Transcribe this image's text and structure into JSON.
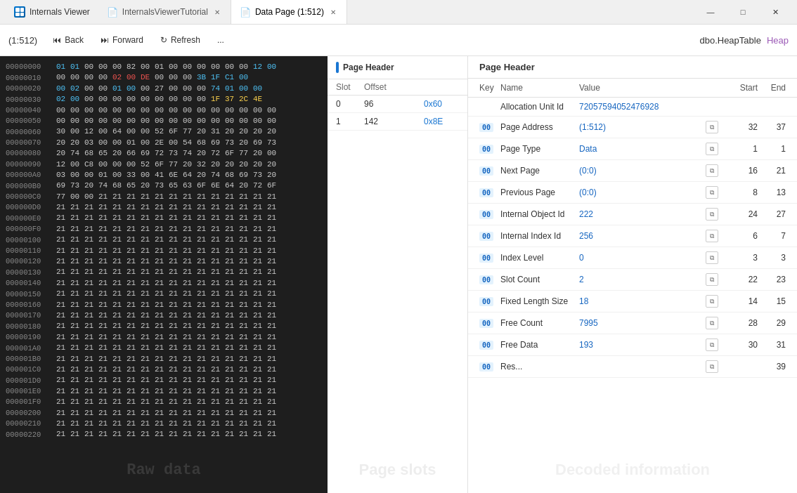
{
  "titlebar": {
    "app_name": "Internals Viewer",
    "tabs": [
      {
        "id": "tutorial",
        "label": "InternalsViewerTutorial",
        "icon": "📄",
        "active": false
      },
      {
        "id": "datapage",
        "label": "Data Page (1:512)",
        "icon": "📄",
        "active": true
      }
    ],
    "window_controls": {
      "minimize": "—",
      "maximize": "□",
      "close": "✕"
    }
  },
  "toolbar": {
    "page_ref": "(1:512)",
    "back_label": "Back",
    "forward_label": "Forward",
    "refresh_label": "Refresh",
    "more_label": "...",
    "dbo_text": "dbo.HeapTable",
    "heap_label": "Heap"
  },
  "hex_panel": {
    "watermark": "Raw data",
    "rows": [
      {
        "addr": "00000000",
        "bytes": "01 01 00 00 00 82 00 01 00 00 00 00 00 00 12 00"
      },
      {
        "addr": "00000010",
        "bytes": "00 00 00 00 02 00 DE 00 00 00 3B 1F C1 00"
      },
      {
        "addr": "00000020",
        "bytes": "00 02 00 00 01 00 00 27 00 00 00 74 01 00 00"
      },
      {
        "addr": "00000030",
        "bytes": "02 00 00 00 00 00 00 00 00 00 00 1F 37 2C 4E"
      },
      {
        "addr": "00000040",
        "bytes": "00 00 00 00 00 00 00 00 00 00 00 00 00 00 00 00"
      },
      {
        "addr": "00000050",
        "bytes": "00 00 00 00 00 00 00 00 00 00 00 00 00 00 00 00"
      },
      {
        "addr": "00000060",
        "bytes": "30 00 12 00 64 00 00 52 6F 77 20 31 20 20 20 20"
      },
      {
        "addr": "00000070",
        "bytes": "20 20 03 00 00 01 00 2E 00 54 68 69 73 20 69 73"
      },
      {
        "addr": "00000080",
        "bytes": "20 74 68 65 20 66 69 72 73 74 20 72 6F 77 20 00"
      },
      {
        "addr": "00000090",
        "bytes": "12 00 C8 00 00 00 52 6F 77 20 32 20 20 20 20 20"
      },
      {
        "addr": "000000A0",
        "bytes": "03 00 00 01 00 33 00 41 6E 64 20 74 68 69 73 20"
      },
      {
        "addr": "000000B0",
        "bytes": "69 73 20 74 68 65 20 73 65 63 6F 6E 64 20 72 6F"
      },
      {
        "addr": "000000C0",
        "bytes": "77 00 00 21 21 21 21 21 21 21 21 21 21 21 21 21"
      },
      {
        "addr": "000000D0",
        "bytes": "21 21 21 21 21 21 21 21 21 21 21 21 21 21 21 21"
      },
      {
        "addr": "000000E0",
        "bytes": "21 21 21 21 21 21 21 21 21 21 21 21 21 21 21 21"
      },
      {
        "addr": "000000F0",
        "bytes": "21 21 21 21 21 21 21 21 21 21 21 21 21 21 21 21"
      },
      {
        "addr": "00000100",
        "bytes": "21 21 21 21 21 21 21 21 21 21 21 21 21 21 21 21"
      },
      {
        "addr": "00000110",
        "bytes": "21 21 21 21 21 21 21 21 21 21 21 21 21 21 21 21"
      },
      {
        "addr": "00000120",
        "bytes": "21 21 21 21 21 21 21 21 21 21 21 21 21 21 21 21"
      },
      {
        "addr": "00000130",
        "bytes": "21 21 21 21 21 21 21 21 21 21 21 21 21 21 21 21"
      },
      {
        "addr": "00000140",
        "bytes": "21 21 21 21 21 21 21 21 21 21 21 21 21 21 21 21"
      },
      {
        "addr": "00000150",
        "bytes": "21 21 21 21 21 21 21 21 21 21 21 21 21 21 21 21"
      },
      {
        "addr": "00000160",
        "bytes": "21 21 21 21 21 21 21 21 21 21 21 21 21 21 21 21"
      },
      {
        "addr": "00000170",
        "bytes": "21 21 21 21 21 21 21 21 21 21 21 21 21 21 21 21"
      },
      {
        "addr": "00000180",
        "bytes": "21 21 21 21 21 21 21 21 21 21 21 21 21 21 21 21"
      },
      {
        "addr": "00000190",
        "bytes": "21 21 21 21 21 21 21 21 21 21 21 21 21 21 21 21"
      },
      {
        "addr": "000001A0",
        "bytes": "21 21 21 21 21 21 21 21 21 21 21 21 21 21 21 21"
      },
      {
        "addr": "000001B0",
        "bytes": "21 21 21 21 21 21 21 21 21 21 21 21 21 21 21 21"
      },
      {
        "addr": "000001C0",
        "bytes": "21 21 21 21 21 21 21 21 21 21 21 21 21 21 21 21"
      },
      {
        "addr": "000001D0",
        "bytes": "21 21 21 21 21 21 21 21 21 21 21 21 21 21 21 21"
      },
      {
        "addr": "000001E0",
        "bytes": "21 21 21 21 21 21 21 21 21 21 21 21 21 21 21 21"
      },
      {
        "addr": "000001F0",
        "bytes": "21 21 21 21 21 21 21 21 21 21 21 21 21 21 21 21"
      },
      {
        "addr": "00000200",
        "bytes": "21 21 21 21 21 21 21 21 21 21 21 21 21 21 21 21"
      },
      {
        "addr": "00000210",
        "bytes": "21 21 21 21 21 21 21 21 21 21 21 21 21 21 21 21"
      },
      {
        "addr": "00000220",
        "bytes": "21 21 21 21 21 21 21 21 21 21 21 21 21 21 21 21"
      }
    ]
  },
  "slots_panel": {
    "header": "Page Header",
    "watermark": "Page slots",
    "col_slot": "Slot",
    "col_offset": "Offset",
    "slots": [
      {
        "slot": "0",
        "offset": "96",
        "hex": "0x60",
        "selected": false
      },
      {
        "slot": "1",
        "offset": "142",
        "hex": "0x8E",
        "selected": false
      }
    ]
  },
  "decoded_panel": {
    "header": "Page Header",
    "watermark": "Decoded information",
    "cols": {
      "key": "Key",
      "name": "Name",
      "value": "Value",
      "start": "Start",
      "end": "End"
    },
    "rows": [
      {
        "key": "",
        "name": "Allocation Unit Id",
        "value": "72057594052476928",
        "start": "",
        "end": ""
      },
      {
        "key": "00",
        "name": "Page Address",
        "value": "(1:512)",
        "start": "32",
        "end": "37"
      },
      {
        "key": "00",
        "name": "Page Type",
        "value": "Data",
        "start": "1",
        "end": "1"
      },
      {
        "key": "00",
        "name": "Next Page",
        "value": "(0:0)",
        "start": "16",
        "end": "21"
      },
      {
        "key": "00",
        "name": "Previous Page",
        "value": "(0:0)",
        "start": "8",
        "end": "13"
      },
      {
        "key": "00",
        "name": "Internal Object Id",
        "value": "222",
        "start": "24",
        "end": "27"
      },
      {
        "key": "00",
        "name": "Internal Index Id",
        "value": "256",
        "start": "6",
        "end": "7"
      },
      {
        "key": "00",
        "name": "Index Level",
        "value": "0",
        "start": "3",
        "end": "3"
      },
      {
        "key": "00",
        "name": "Slot Count",
        "value": "2",
        "start": "22",
        "end": "23"
      },
      {
        "key": "00",
        "name": "Fixed Length Size",
        "value": "18",
        "start": "14",
        "end": "15"
      },
      {
        "key": "00",
        "name": "Free Count",
        "value": "7995",
        "start": "28",
        "end": "29"
      },
      {
        "key": "00",
        "name": "Free Data",
        "value": "193",
        "start": "30",
        "end": "31"
      },
      {
        "key": "00",
        "name": "Res...",
        "value": "",
        "start": "",
        "end": "39"
      }
    ]
  }
}
